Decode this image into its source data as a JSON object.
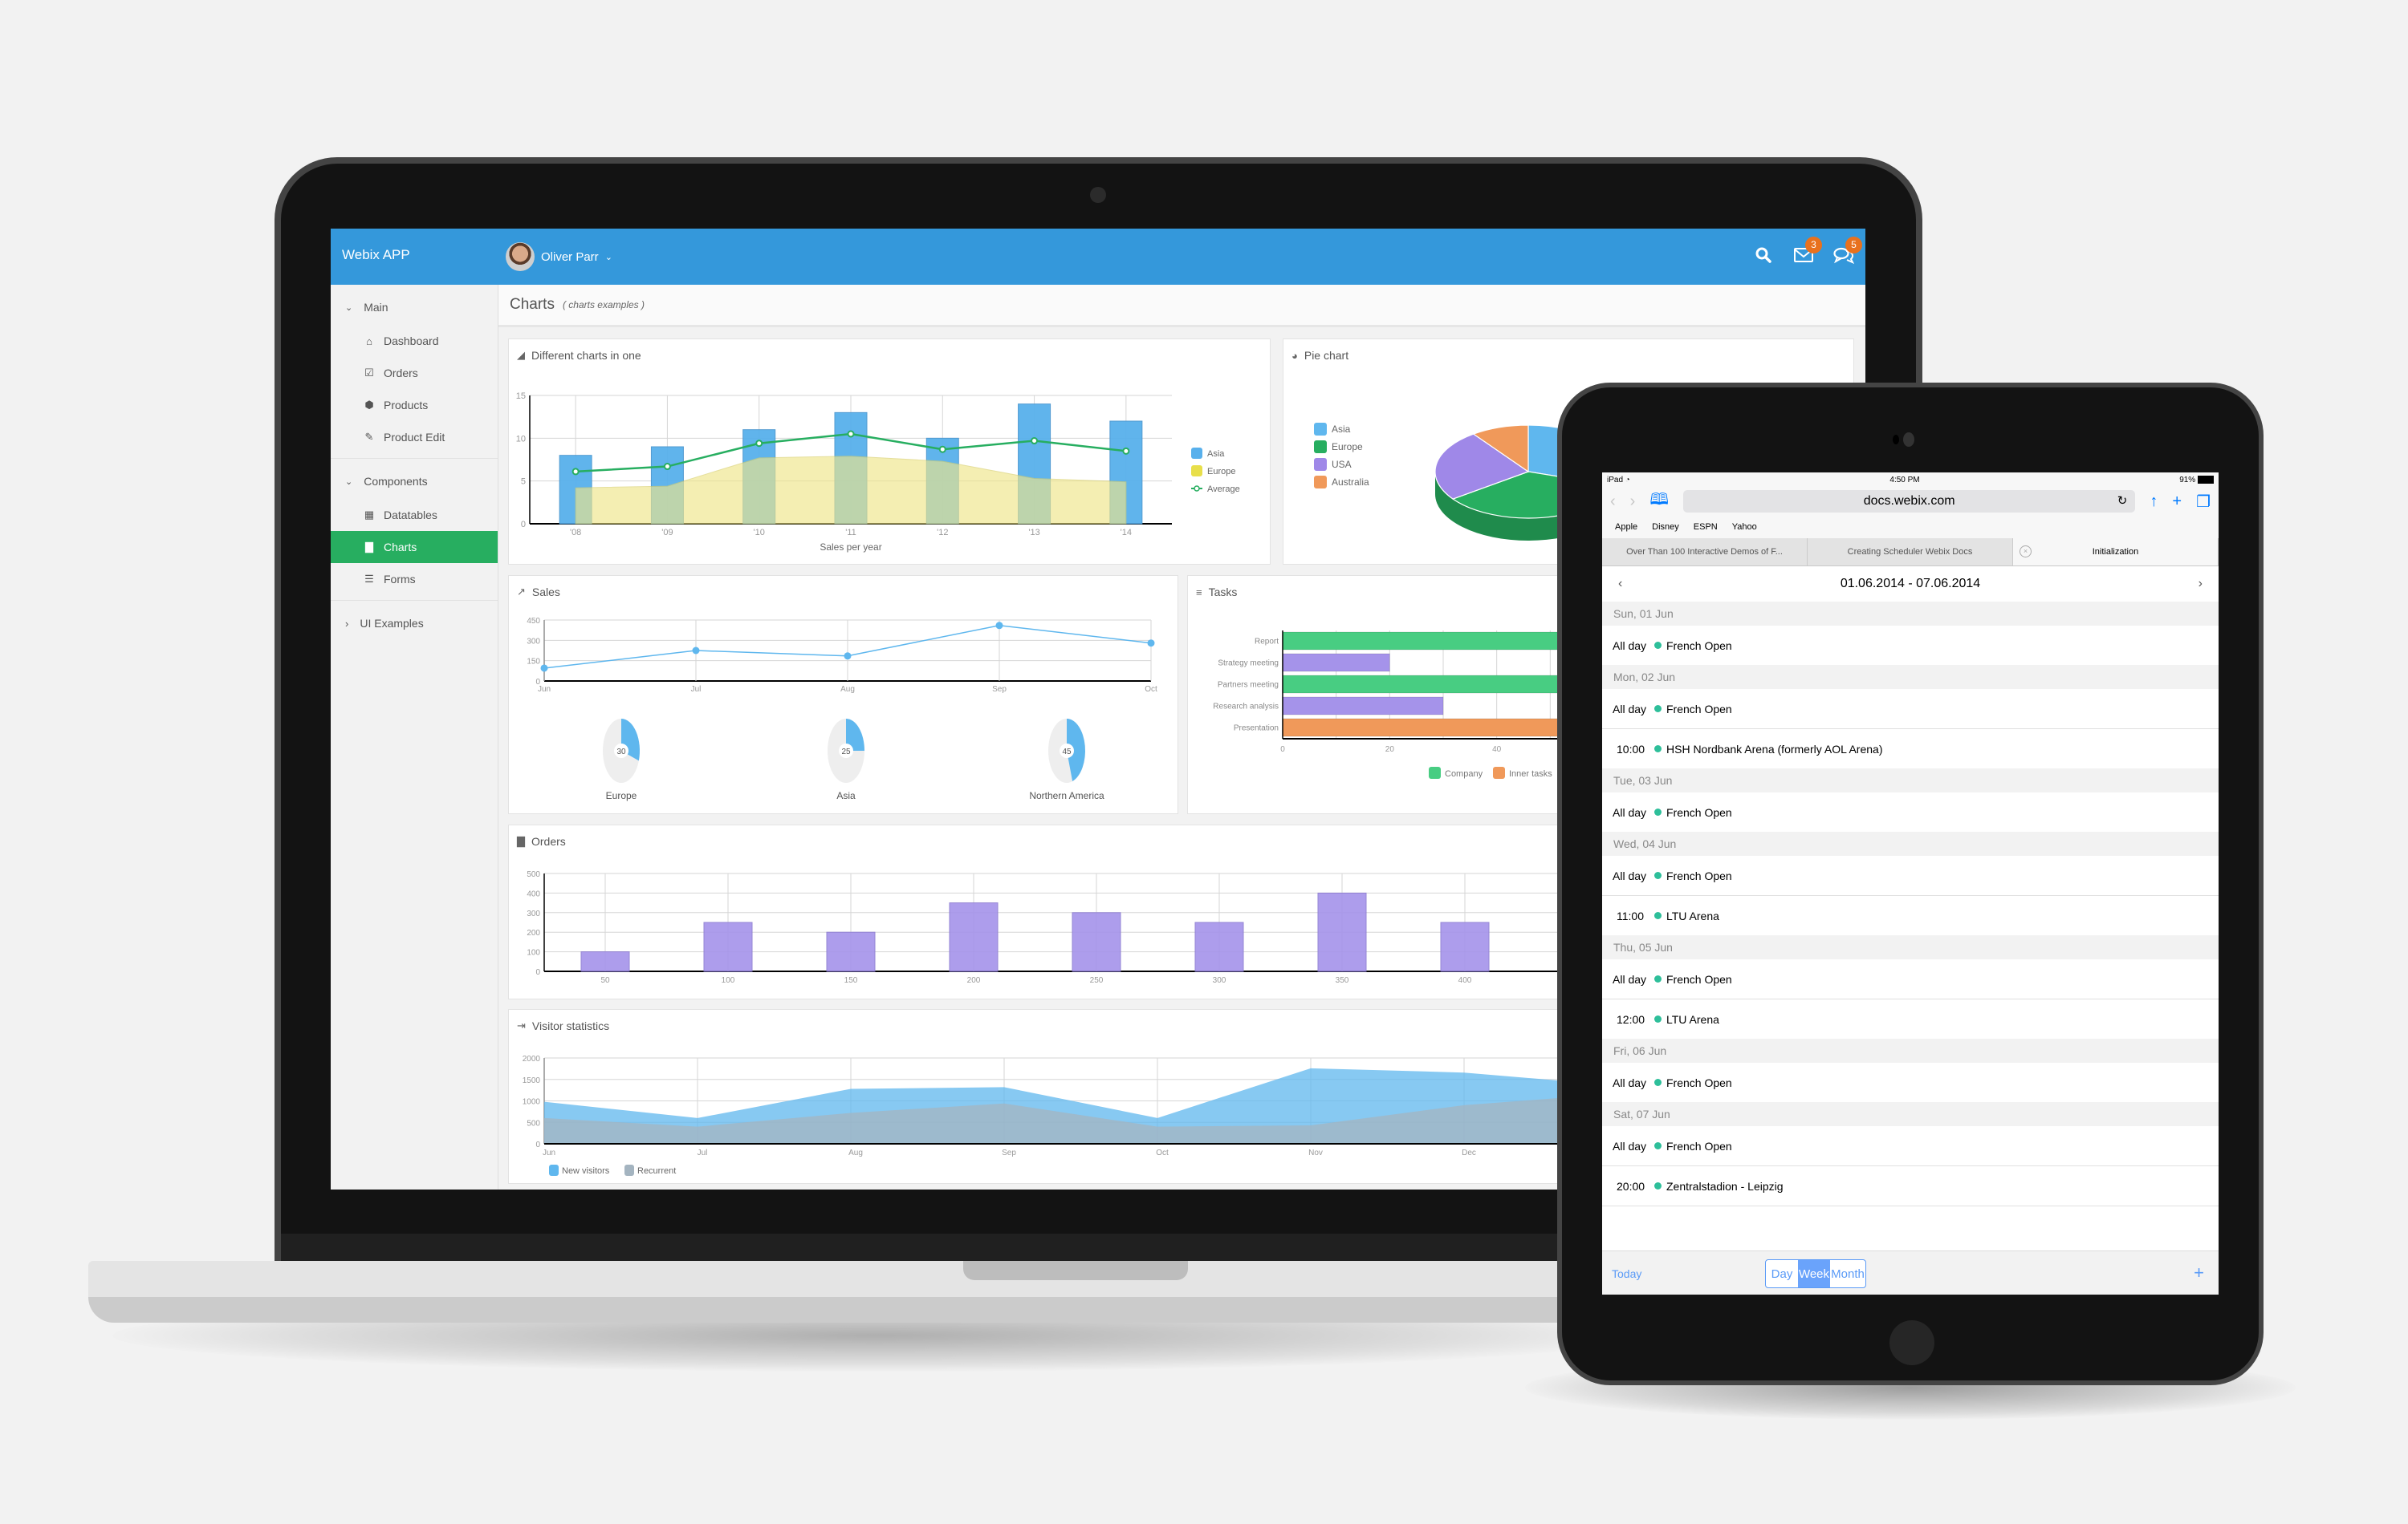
{
  "webix_app": {
    "title": "Webix APP",
    "user": {
      "name": "Oliver Parr",
      "dropdown_icon": "chevron-down-icon"
    },
    "topbar_icons": [
      {
        "icon": "search-icon",
        "badge": null
      },
      {
        "icon": "mail-icon",
        "badge": "3"
      },
      {
        "icon": "chat-icon",
        "badge": "5"
      }
    ],
    "sidebar": {
      "groups": [
        {
          "label": "Main",
          "expanded": true,
          "items": [
            {
              "label": "Dashboard",
              "icon": "home-icon"
            },
            {
              "label": "Orders",
              "icon": "check-square-icon"
            },
            {
              "label": "Products",
              "icon": "cube-icon"
            },
            {
              "label": "Product Edit",
              "icon": "edit-icon"
            }
          ]
        },
        {
          "label": "Components",
          "expanded": true,
          "items": [
            {
              "label": "Datatables",
              "icon": "table-icon"
            },
            {
              "label": "Charts",
              "icon": "bar-chart-icon",
              "active": true
            },
            {
              "label": "Forms",
              "icon": "form-icon"
            }
          ]
        },
        {
          "label": "UI Examples",
          "expanded": false,
          "items": []
        }
      ]
    },
    "page": {
      "title": "Charts",
      "subtitle": "( charts examples )"
    },
    "accent_colors": {
      "header": "#3498db",
      "active": "#27ae60",
      "badge": "#e8711e"
    }
  },
  "chart_data": [
    {
      "id": "different-charts",
      "title": "Different charts in one",
      "type": "bar",
      "categories": [
        "'08",
        "'09",
        "'10",
        "'11",
        "'12",
        "'13",
        "'14"
      ],
      "xlabel": "Sales per year",
      "ylim": [
        0,
        15
      ],
      "yticks": [
        "0",
        "5",
        "10",
        "15"
      ],
      "series": [
        {
          "name": "Asia",
          "type": "bar",
          "color": "#58b0ec",
          "values": [
            8,
            9,
            11,
            13,
            10,
            14,
            12
          ]
        },
        {
          "name": "Europe",
          "type": "area",
          "color": "#efe68a",
          "values": [
            4.2,
            4.4,
            7.7,
            7.9,
            7.3,
            5.3,
            4.9
          ]
        },
        {
          "name": "Average",
          "type": "line",
          "color": "#27ae60",
          "values": [
            6.1,
            6.7,
            9.4,
            10.5,
            8.7,
            9.7,
            8.5
          ]
        }
      ],
      "legend": "right"
    },
    {
      "id": "pie-chart",
      "title": "Pie chart",
      "type": "pie",
      "categories": [
        "Asia",
        "Europe",
        "USA",
        "Australia"
      ],
      "colors": [
        "#5fb7ee",
        "#27ae60",
        "#9f88e8",
        "#f0995a"
      ],
      "values": [
        30,
        35,
        25,
        10
      ],
      "legend": "left"
    },
    {
      "id": "sales",
      "title": "Sales",
      "type": "line",
      "categories": [
        "Jun",
        "Jul",
        "Aug",
        "Sep",
        "Oct"
      ],
      "values": [
        95,
        225,
        185,
        410,
        280
      ],
      "ylim": [
        0,
        450
      ],
      "yticks": [
        "0",
        "150",
        "300",
        "450"
      ],
      "color": "#5fb7ee"
    },
    {
      "id": "sales-donuts",
      "type": "pie",
      "items": [
        {
          "label": "Europe",
          "value": 30
        },
        {
          "label": "Asia",
          "value": 25
        },
        {
          "label": "Northern America",
          "value": 45
        }
      ],
      "color": "#5fb7ee",
      "track_color": "#eeeeee"
    },
    {
      "id": "tasks",
      "title": "Tasks",
      "type": "bar",
      "orientation": "horizontal",
      "categories": [
        "Report",
        "Strategy meeting",
        "Partners meeting",
        "Research analysis",
        "Presentation"
      ],
      "values": [
        55,
        20,
        55,
        30,
        55
      ],
      "colors": [
        "#48cd82",
        "#a593ea",
        "#48cd82",
        "#a593ea",
        "#f0995a"
      ],
      "xticks": [
        "0",
        "20",
        "40"
      ],
      "xlim": [
        0,
        60
      ],
      "legend_items": [
        {
          "name": "Company",
          "color": "#48cd82"
        },
        {
          "name": "Inner tasks",
          "color": "#f0995a"
        }
      ]
    },
    {
      "id": "orders",
      "title": "Orders",
      "type": "bar",
      "categories": [
        "50",
        "100",
        "150",
        "200",
        "250",
        "300",
        "350",
        "400"
      ],
      "values": [
        100,
        250,
        200,
        350,
        300,
        250,
        400,
        250
      ],
      "ylim": [
        0,
        500
      ],
      "yticks": [
        "0",
        "100",
        "200",
        "300",
        "400",
        "500"
      ],
      "color": "#a593ea"
    },
    {
      "id": "visitors",
      "title": "Visitor statistics",
      "type": "area",
      "categories": [
        "Jun",
        "Jul",
        "Aug",
        "Sep",
        "Oct",
        "Nov",
        "Dec"
      ],
      "ylim": [
        0,
        2000
      ],
      "yticks": [
        "0",
        "500",
        "1000",
        "1500",
        "2000"
      ],
      "series": [
        {
          "name": "New visitors",
          "color": "#5fb7ee",
          "values": [
            980,
            600,
            1280,
            1320,
            600,
            1760,
            1660,
            1360
          ]
        },
        {
          "name": "Recurrent",
          "color": "#a4b4c0",
          "values": [
            600,
            400,
            720,
            940,
            400,
            430,
            900,
            1170
          ]
        }
      ]
    }
  ],
  "ipad": {
    "status": {
      "device": "iPad",
      "time": "4:50 PM",
      "battery": "91%"
    },
    "safari": {
      "url": "docs.webix.com",
      "bookmarks": [
        "Apple",
        "Disney",
        "ESPN",
        "Yahoo"
      ],
      "tabs": [
        {
          "label": "Over Than 100 Interactive Demos of F...",
          "active": false
        },
        {
          "label": "Creating Scheduler Webix Docs",
          "active": false
        },
        {
          "label": "Initialization",
          "active": true
        }
      ]
    },
    "scheduler": {
      "range": "01.06.2014 - 07.06.2014",
      "days": [
        {
          "header": "Sun, 01 Jun",
          "events": [
            {
              "time": "All day",
              "title": "French Open"
            }
          ]
        },
        {
          "header": "Mon, 02 Jun",
          "events": [
            {
              "time": "All day",
              "title": "French Open"
            },
            {
              "time": "10:00",
              "title": "HSH Nordbank Arena (formerly AOL Arena)"
            }
          ]
        },
        {
          "header": "Tue, 03 Jun",
          "events": [
            {
              "time": "All day",
              "title": "French Open"
            }
          ]
        },
        {
          "header": "Wed, 04 Jun",
          "events": [
            {
              "time": "All day",
              "title": "French Open"
            },
            {
              "time": "11:00",
              "title": "LTU Arena"
            }
          ]
        },
        {
          "header": "Thu, 05 Jun",
          "events": [
            {
              "time": "All day",
              "title": "French Open"
            },
            {
              "time": "12:00",
              "title": "LTU Arena"
            }
          ]
        },
        {
          "header": "Fri, 06 Jun",
          "events": [
            {
              "time": "All day",
              "title": "French Open"
            }
          ]
        },
        {
          "header": "Sat, 07 Jun",
          "events": [
            {
              "time": "All day",
              "title": "French Open"
            },
            {
              "time": "20:00",
              "title": "Zentralstadion - Leipzig"
            }
          ]
        }
      ],
      "footer": {
        "today": "Today",
        "views": [
          "Day",
          "Week",
          "Month"
        ],
        "active_view": "Week",
        "add": "+"
      },
      "event_color": "#2ebf9a"
    }
  }
}
